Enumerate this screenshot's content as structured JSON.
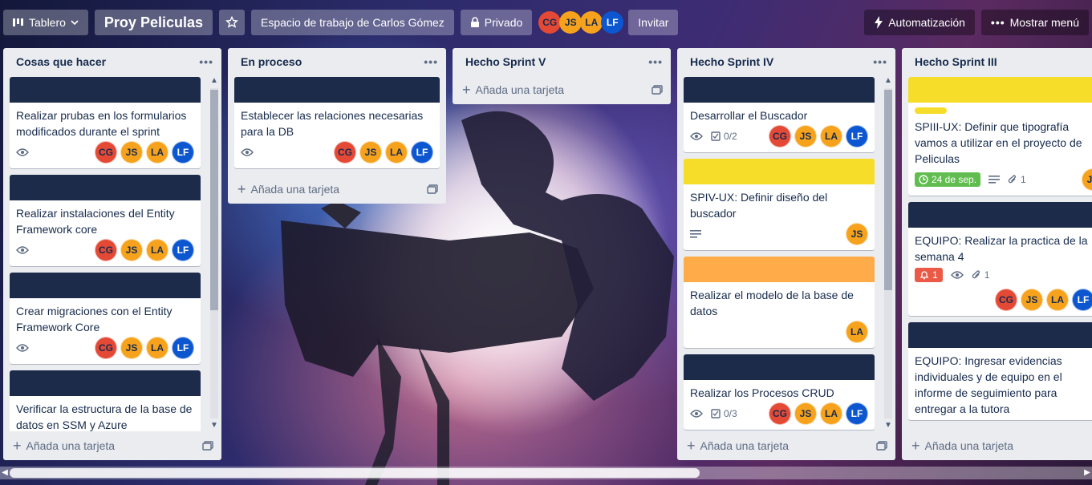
{
  "header": {
    "view_label": "Tablero",
    "board_title": "Proy Peliculas",
    "workspace": "Espacio de trabajo de Carlos Gómez",
    "visibility": "Privado",
    "members": [
      "CG",
      "JS",
      "LA",
      "LF"
    ],
    "invite": "Invitar",
    "automation": "Automatización",
    "show_menu": "Mostrar menú"
  },
  "add_card_label": "Añada una tarjeta",
  "colors": {
    "navy_cover": "#1c2b4a",
    "yellow_cover": "#f5dd29",
    "orange_cover": "#ffab4a",
    "due_green": "#61bd4f",
    "alert_red": "#eb5a46"
  },
  "lists": [
    {
      "title": "Cosas que hacer",
      "cards": [
        {
          "title": "Realizar prubas en los formularios modificados durante el sprint",
          "members": [
            "CG",
            "JS",
            "LA",
            "LF"
          ]
        },
        {
          "title": "Realizar instalaciones del Entity Framework core",
          "members": [
            "CG",
            "JS",
            "LA",
            "LF"
          ]
        },
        {
          "title": "Crear migraciones con el Entity Framework Core",
          "members": [
            "CG",
            "JS",
            "LA",
            "LF"
          ]
        },
        {
          "title": "Verificar la estructura de la base de datos en SSM y Azure"
        }
      ]
    },
    {
      "title": "En proceso",
      "cards": [
        {
          "title": "Establecer las relaciones necesarias para la DB",
          "members": [
            "CG",
            "JS",
            "LA",
            "LF"
          ]
        }
      ]
    },
    {
      "title": "Hecho Sprint V",
      "cards": []
    },
    {
      "title": "Hecho Sprint IV",
      "cards": [
        {
          "title": "Desarrollar el Buscador",
          "checklist": "0/2",
          "members": [
            "CG",
            "JS",
            "LA",
            "LF"
          ]
        },
        {
          "title": "SPIV-UX: Definir diseño del buscador",
          "members": [
            "JS"
          ]
        },
        {
          "title": "Realizar el modelo de la base de datos",
          "members": [
            "LA"
          ]
        },
        {
          "title": "Realizar los Procesos CRUD",
          "checklist": "0/3",
          "members": [
            "CG",
            "JS",
            "LA",
            "LF"
          ]
        }
      ]
    },
    {
      "title": "Hecho Sprint III",
      "cards": [
        {
          "title": "SPIII-UX: Definir que tipografía vamos a utilizar en el proyecto de Peliculas",
          "due": "24 de sep.",
          "attachments": "1",
          "members": [
            "JS"
          ]
        },
        {
          "title": "EQUIPO: Realizar la practica de la semana 4",
          "notifications": "1",
          "attachments": "1",
          "members": [
            "CG",
            "JS",
            "LA",
            "LF"
          ]
        },
        {
          "title": "EQUIPO: Ingresar evidencias individuales y de equipo en el informe de seguimiento para entregar a la tutora"
        }
      ]
    }
  ]
}
